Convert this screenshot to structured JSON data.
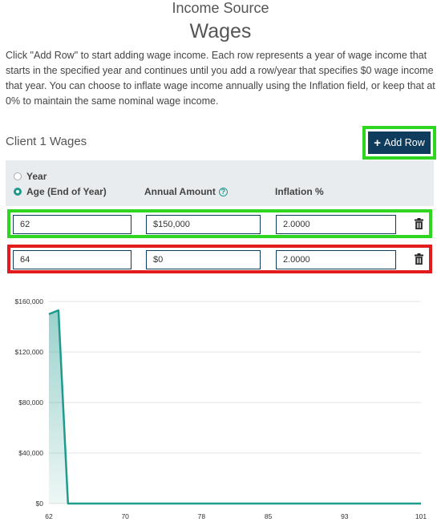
{
  "header": {
    "subtitle": "Income Source",
    "title": "Wages",
    "intro": "Click \"Add Row\" to start adding wage income. Each row represents a year of wage income that starts in the specified year and continues until you add a row/year that specifies $0 wage income that year. You can choose to inflate wage income annually using the Inflation field, or keep that at 0% to maintain the same nominal wage income."
  },
  "section": {
    "title": "Client 1 Wages",
    "add_row_label": "Add Row"
  },
  "table_header": {
    "radio_year": "Year",
    "radio_age": "Age (End of Year)",
    "selected": "age",
    "col_amount": "Annual Amount",
    "col_inflation": "Inflation %"
  },
  "rows": [
    {
      "age": "62",
      "amount": "$150,000",
      "inflation": "2.0000",
      "highlight": "green"
    },
    {
      "age": "64",
      "amount": "$0",
      "inflation": "2.0000",
      "highlight": "red"
    }
  ],
  "colors": {
    "accent": "#1f9b8e",
    "button": "#0f3b5c",
    "highlight_green": "#2ed61f",
    "highlight_red": "#e21c1c"
  },
  "chart_data": {
    "type": "area",
    "title": "",
    "xlabel": "",
    "ylabel": "",
    "x_ticks": [
      62,
      70,
      78,
      85,
      93,
      101
    ],
    "y_ticks": [
      "$0",
      "$40,000",
      "$80,000",
      "$120,000",
      "$160,000"
    ],
    "xlim": [
      62,
      101
    ],
    "ylim": [
      0,
      160000
    ],
    "grid": true,
    "series": [
      {
        "x": [
          62,
          63,
          64,
          101
        ],
        "y": [
          150000,
          153000,
          0,
          0
        ]
      }
    ]
  }
}
